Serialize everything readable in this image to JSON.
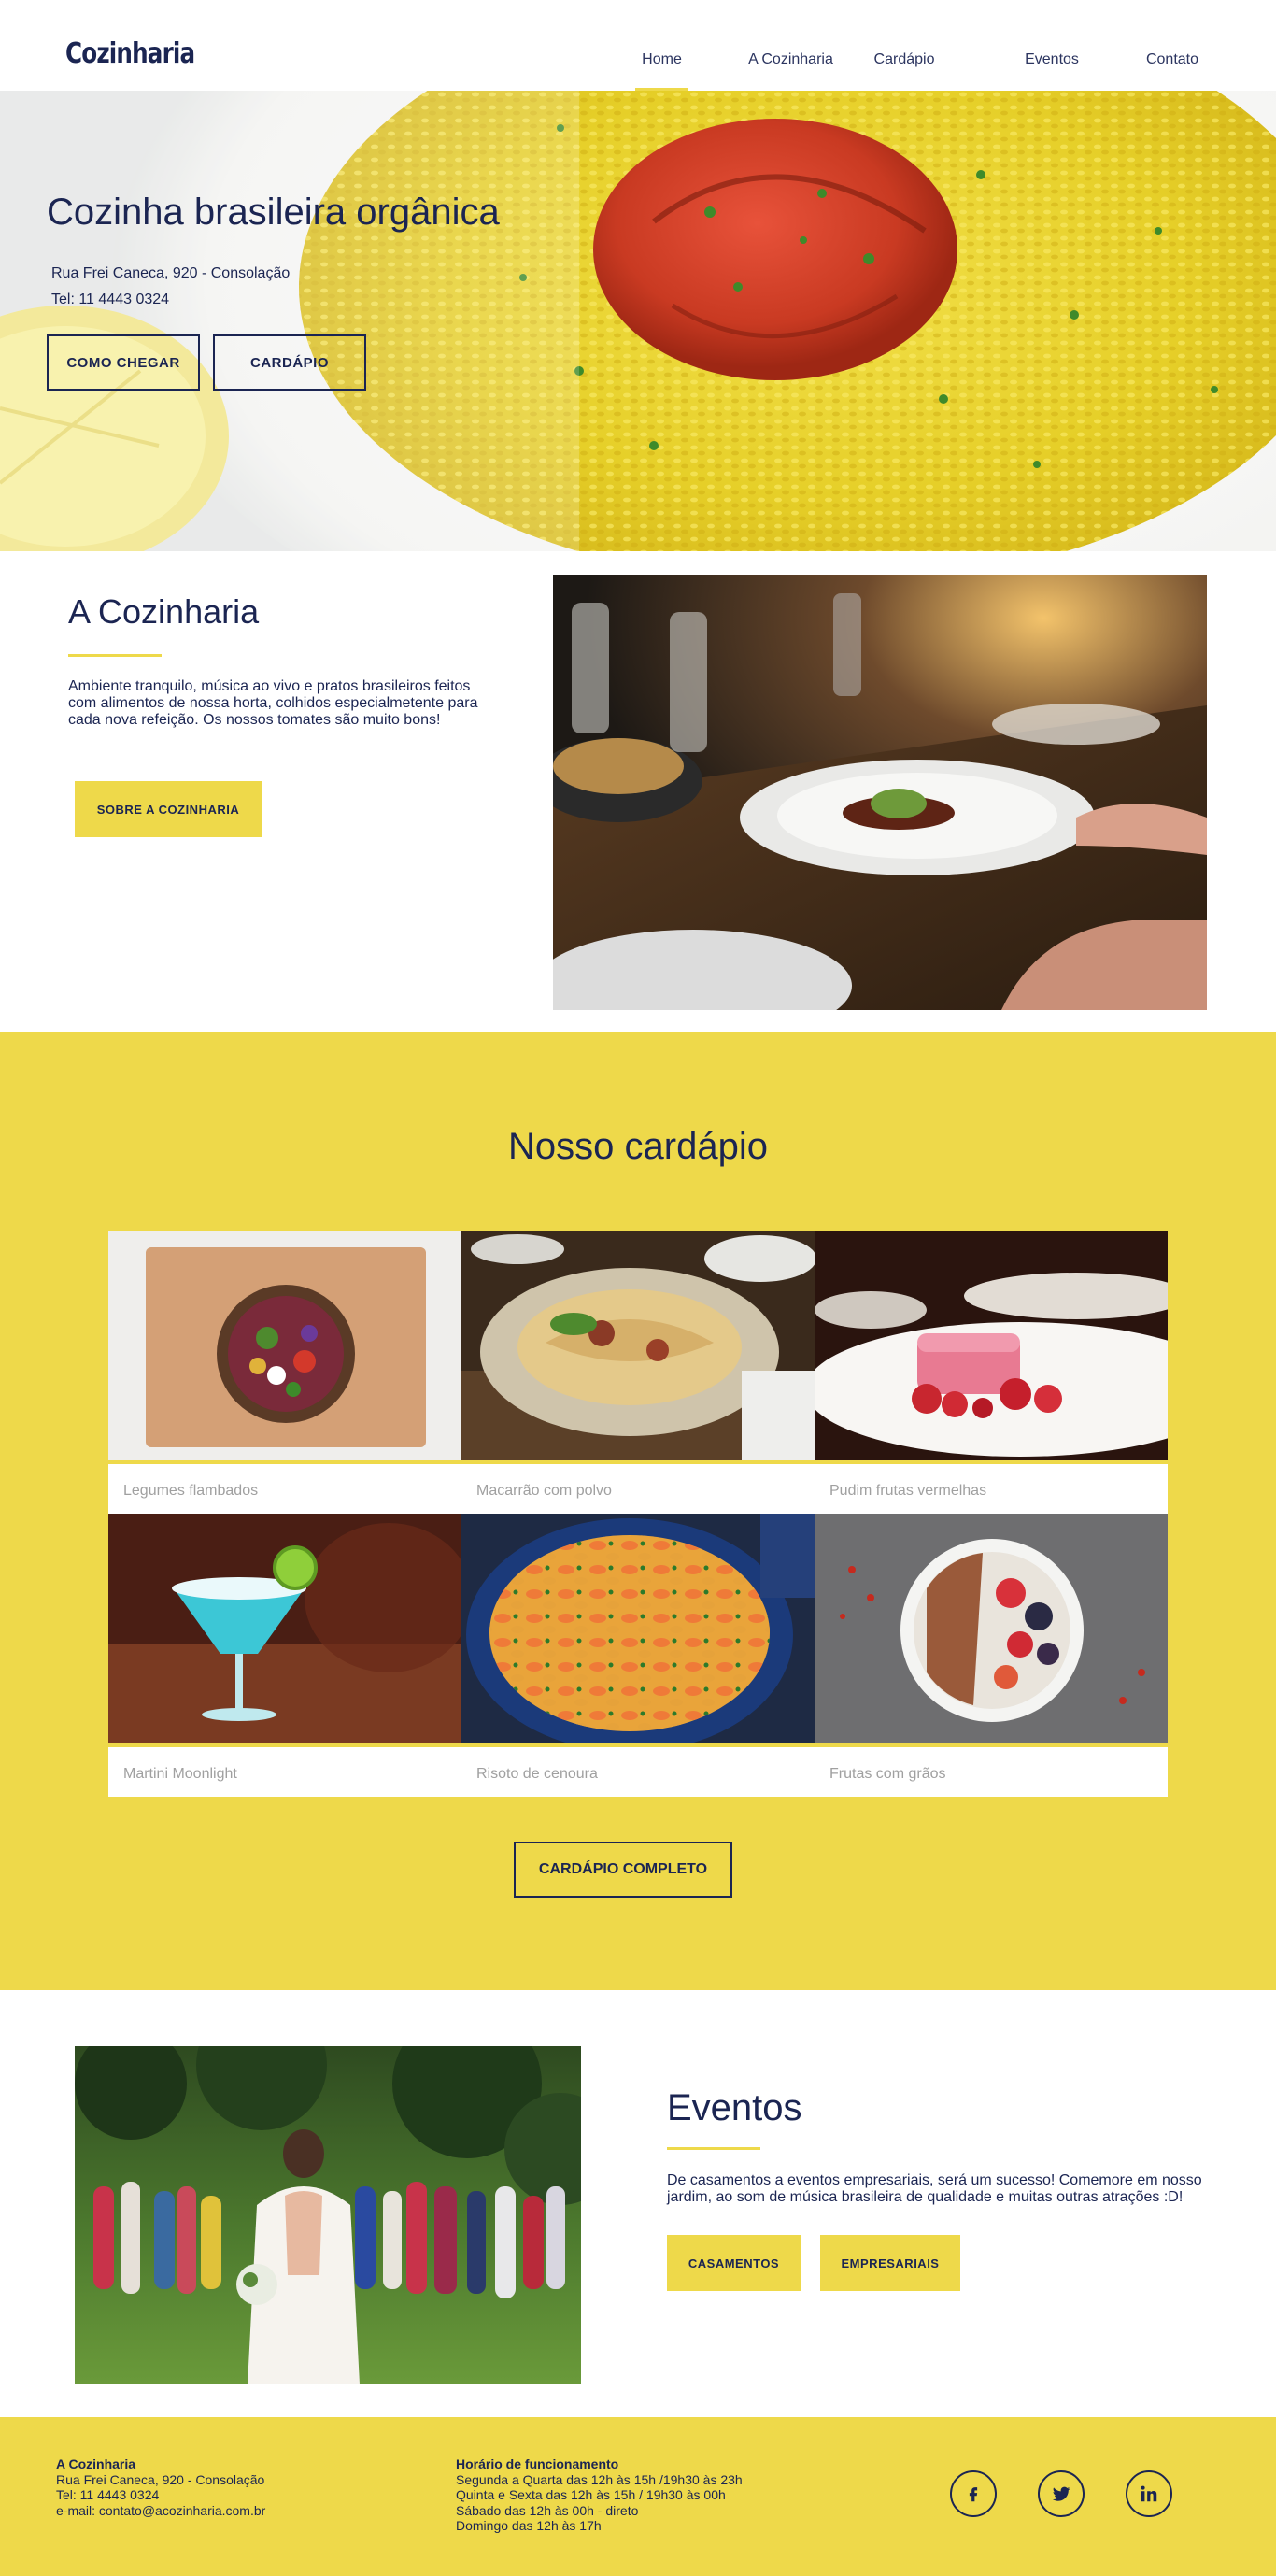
{
  "brand": {
    "logo": "Cozinharia",
    "accent_color": "#eed94a",
    "primary_color": "#1b2552"
  },
  "nav": {
    "items": [
      {
        "label": "Home",
        "active": true
      },
      {
        "label": "A Cozinharia",
        "active": false
      },
      {
        "label": "Cardápio",
        "active": false
      },
      {
        "label": "Eventos",
        "active": false
      },
      {
        "label": "Contato",
        "active": false
      }
    ]
  },
  "hero": {
    "title": "Cozinha brasileira orgânica",
    "address": "Rua Frei Caneca, 920 - Consolação",
    "phone": "Tel: 11 4443 0324",
    "btn_directions": "COMO CHEGAR",
    "btn_menu": "CARDÁPIO"
  },
  "about": {
    "title": "A Cozinharia",
    "text": "Ambiente tranquilo, música ao vivo e pratos brasileiros feitos com alimentos de nossa horta, colhidos especialmetente para cada nova refeição. Os nossos tomates são muito bons!",
    "button": "SOBRE A COZINHARIA"
  },
  "menu": {
    "title": "Nosso cardápio",
    "items": [
      {
        "caption": "Legumes flambados"
      },
      {
        "caption": "Macarrão com polvo"
      },
      {
        "caption": "Pudim frutas vermelhas"
      },
      {
        "caption": "Martini Moonlight"
      },
      {
        "caption": "Risoto de cenoura"
      },
      {
        "caption": "Frutas com grãos"
      }
    ],
    "button": "CARDÁPIO COMPLETO"
  },
  "events": {
    "title": "Eventos",
    "text": "De casamentos a eventos empresariais, será um sucesso! Comemore em nosso jardim, ao som de música brasileira de qualidade e muitas outras atrações :D!",
    "btn_weddings": "CASAMENTOS",
    "btn_corporate": "EMPRESARIAIS"
  },
  "footer": {
    "contact": {
      "heading": "A Cozinharia",
      "address": "Rua Frei Caneca, 920 - Consolação",
      "phone": "Tel: 11 4443 0324",
      "email": "e-mail: contato@acozinharia.com.br"
    },
    "hours": {
      "heading": "Horário de funcionamento",
      "line1": "Segunda a Quarta das 12h às 15h /19h30 às 23h",
      "line2": "Quinta e Sexta das 12h às 15h / 19h30 às 00h",
      "line3": "Sábado das 12h às 00h - direto",
      "line4": "Domingo das 12h às 17h"
    },
    "social": [
      {
        "icon": "facebook-icon"
      },
      {
        "icon": "twitter-icon"
      },
      {
        "icon": "linkedin-icon"
      }
    ]
  }
}
